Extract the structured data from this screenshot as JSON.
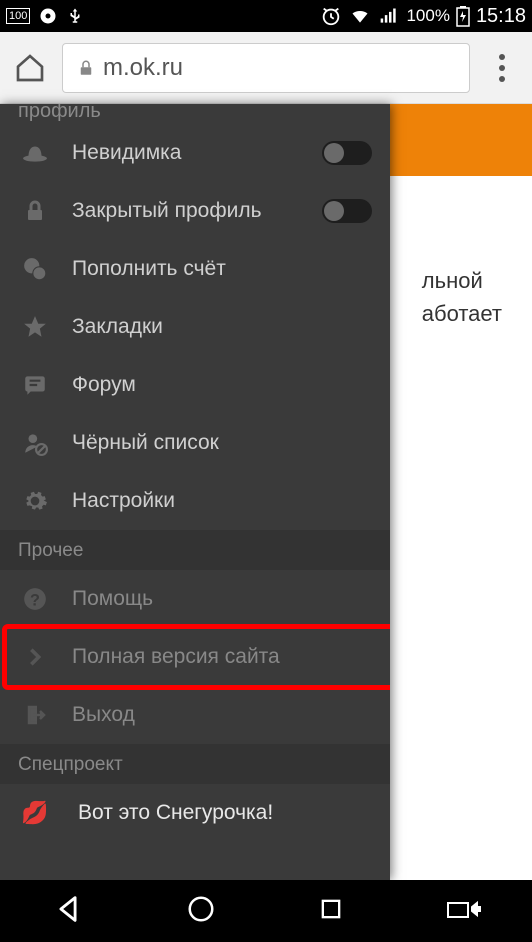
{
  "status_bar": {
    "battery_small": "100",
    "battery_percent": "100%",
    "time": "15:18"
  },
  "browser": {
    "url": "m.ok.ru"
  },
  "background_text": {
    "line1": "льной",
    "line2": "аботает"
  },
  "sidebar": {
    "header_partial": "профиль",
    "items": [
      {
        "label": "Невидимка"
      },
      {
        "label": "Закрытый профиль"
      },
      {
        "label": "Пополнить счёт"
      },
      {
        "label": "Закладки"
      },
      {
        "label": "Форум"
      },
      {
        "label": "Чёрный список"
      },
      {
        "label": "Настройки"
      }
    ],
    "section_other": "Прочее",
    "other_items": [
      {
        "label": "Помощь"
      },
      {
        "label": "Полная версия сайта"
      },
      {
        "label": "Выход"
      }
    ],
    "section_special": "Спецпроект",
    "special_item": {
      "label": "Вот это Снегурочка!"
    }
  }
}
